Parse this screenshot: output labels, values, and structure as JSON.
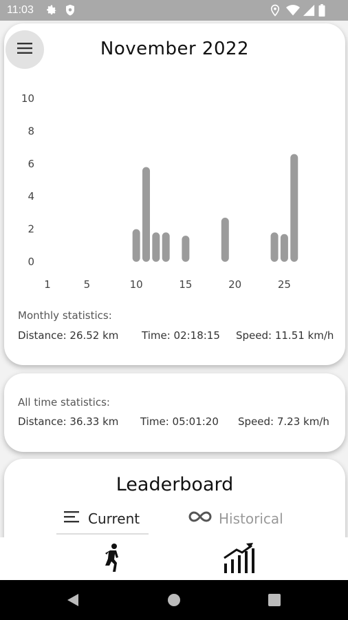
{
  "status_bar": {
    "time": "11:03",
    "left_icons": [
      "gear-icon",
      "shield-icon"
    ],
    "right_icons": [
      "location-icon",
      "wifi-icon",
      "signal-icon",
      "battery-icon"
    ]
  },
  "header": {
    "title": "November 2022",
    "menu_icon": "hamburger-menu-icon"
  },
  "chart_data": {
    "type": "bar",
    "x": [
      10,
      11,
      12,
      13,
      15,
      19,
      24,
      25,
      26
    ],
    "values": [
      2.0,
      5.8,
      1.8,
      1.8,
      1.6,
      2.7,
      1.8,
      1.7,
      6.6
    ],
    "xticks": [
      1,
      5,
      10,
      15,
      20,
      25
    ],
    "yticks": [
      0,
      2,
      4,
      6,
      8,
      10
    ],
    "xlim": [
      1,
      30
    ],
    "ylim": [
      0,
      10
    ],
    "bar_color": "#9b9b9b",
    "grid": false,
    "title": "",
    "xlabel": "",
    "ylabel": ""
  },
  "monthly": {
    "label": "Monthly statistics:",
    "distance": "Distance: 26.52 km",
    "time": "Time: 02:18:15",
    "speed": "Speed: 11.51 km/h"
  },
  "all_time": {
    "label": "All time statistics:",
    "distance": "Distance: 36.33 km",
    "time": "Time: 05:01:20",
    "speed": "Speed: 7.23 km/h"
  },
  "leaderboard": {
    "title": "Leaderboard",
    "tabs": [
      {
        "label": "Current",
        "icon": "list-icon",
        "active": true
      },
      {
        "label": "Historical",
        "icon": "infinity-icon",
        "active": false
      }
    ]
  },
  "bottom_nav": {
    "items": [
      {
        "icon": "runner-icon"
      },
      {
        "icon": "stats-chart-icon"
      }
    ]
  },
  "system_nav": {
    "buttons": [
      "back-icon",
      "home-icon",
      "recents-icon"
    ]
  },
  "colors": {
    "status_bar": "#a9a9a9",
    "bar": "#9b9b9b",
    "card": "#ffffff",
    "background": "#f2f2f2"
  }
}
